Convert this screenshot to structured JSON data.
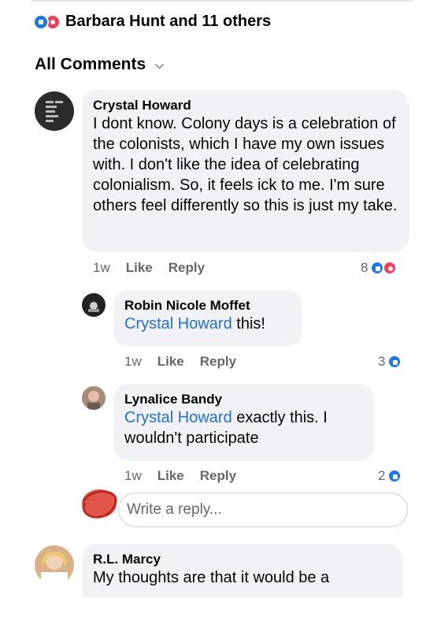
{
  "reactions_summary": {
    "text": "Barbara Hunt and 11 others"
  },
  "comments_header": {
    "label": "All Comments"
  },
  "comments": [
    {
      "author": "Crystal Howard",
      "text": "I dont know. Colony days is a celebration of the colonists, which I have my own issues with. I don't like the idea of celebrating colonialism. So, it feels ick to me. I'm sure others feel differently so this is just my take.",
      "time": "1w",
      "like_label": "Like",
      "reply_label": "Reply",
      "reaction_count": "8",
      "replies": [
        {
          "author": "Robin Nicole Moffet",
          "mention": "Crystal Howard",
          "text": " this!",
          "time": "1w",
          "like_label": "Like",
          "reply_label": "Reply",
          "reaction_count": "3"
        },
        {
          "author": "Lynalice Bandy",
          "mention": "Crystal Howard",
          "text": " exactly this. I wouldn't participate",
          "time": "1w",
          "like_label": "Like",
          "reply_label": "Reply",
          "reaction_count": "2"
        }
      ]
    },
    {
      "author": "R.L. Marcy",
      "text": "My thoughts are that it would be a"
    }
  ],
  "reply_input": {
    "placeholder": "Write a reply..."
  },
  "colors": {
    "accent": "#1877f2",
    "love": "#f33e58",
    "mention": "#216fdb",
    "bubble": "#f0f2f5"
  }
}
